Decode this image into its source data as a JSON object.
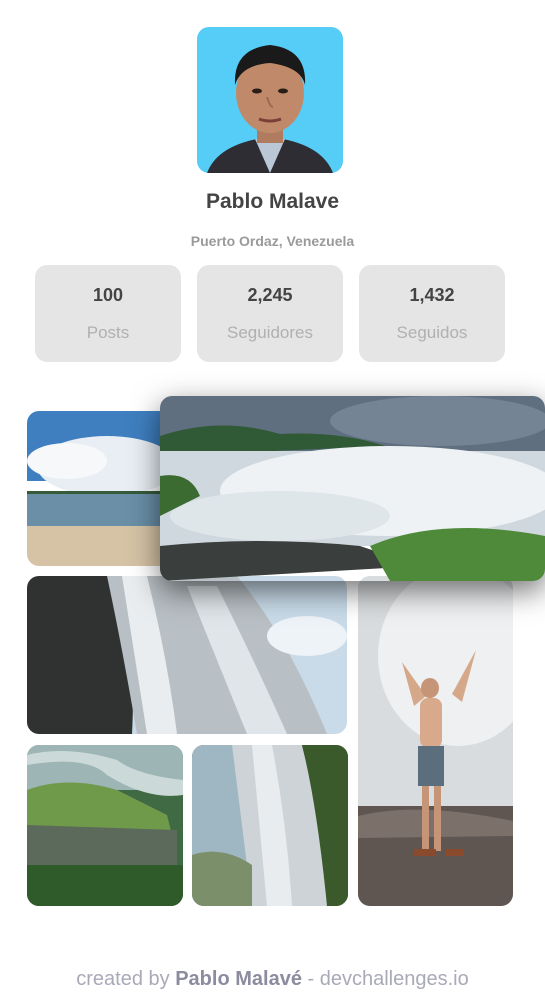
{
  "profile": {
    "name": "Pablo Malave",
    "location": "Puerto Ordaz, Venezuela"
  },
  "stats": [
    {
      "value": "100",
      "label": "Posts"
    },
    {
      "value": "2,245",
      "label": "Seguidores"
    },
    {
      "value": "1,432",
      "label": "Seguidos"
    }
  ],
  "gallery": {
    "photos": [
      {
        "subject": "beach-lagoon"
      },
      {
        "subject": "waterfall-rapids"
      },
      {
        "subject": "waterfall-cliff"
      },
      {
        "subject": "man-at-waterfall"
      },
      {
        "subject": "tepui-aerial"
      },
      {
        "subject": "waterfall-cave"
      }
    ]
  },
  "footer": {
    "prefix": "created by ",
    "author": "Pablo Malavé",
    "suffix": " - devchallenges.io"
  },
  "colors": {
    "avatar_bg": "#55cdf7",
    "stat_bg": "#e5e5e5",
    "name": "#444444",
    "muted": "#9a9a9a"
  }
}
